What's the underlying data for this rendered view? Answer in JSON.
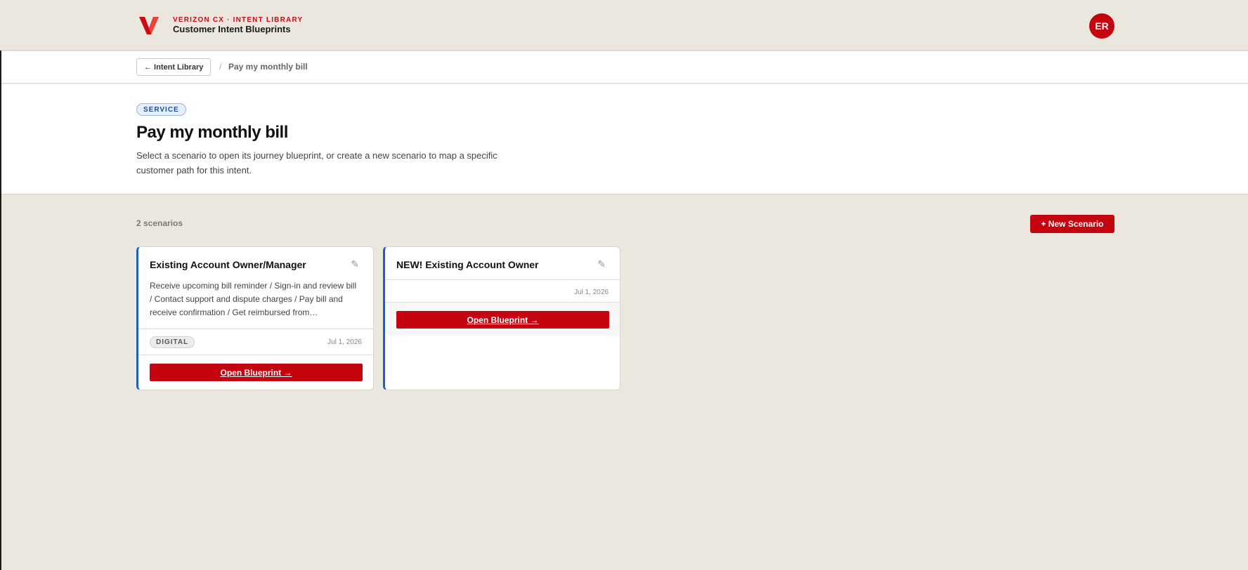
{
  "header": {
    "kicker": "VERIZON CX · INTENT LIBRARY",
    "title": "Customer Intent Blueprints",
    "avatar_initials": "ER",
    "brand_color": "#cc0a14"
  },
  "breadcrumb": {
    "back_label": "← Intent Library",
    "separator": "/",
    "current": "Pay my monthly bill"
  },
  "intent": {
    "category_badge": "SERVICE",
    "title": "Pay my monthly bill",
    "description": "Select a scenario to open its journey blueprint, or create a new scenario to map a specific customer path for this intent."
  },
  "scenarios": {
    "count_label": "2 scenarios",
    "new_button_label": "+ New Scenario",
    "items": [
      {
        "title": "Existing Account Owner/Manager",
        "description": "Receive upcoming bill reminder / Sign-in and review bill / Contact support and dispute charges / Pay bill and receive confirmation / Get reimbursed from…",
        "tag": "DIGITAL",
        "date": "Jul 1, 2026",
        "open_label": "Open Blueprint →",
        "edit_icon": "pencil-icon"
      },
      {
        "title": "NEW! Existing Account Owner",
        "description": "",
        "tag": "",
        "date": "Jul 1, 2026",
        "open_label": "Open Blueprint →",
        "edit_icon": "pencil-icon"
      }
    ]
  }
}
